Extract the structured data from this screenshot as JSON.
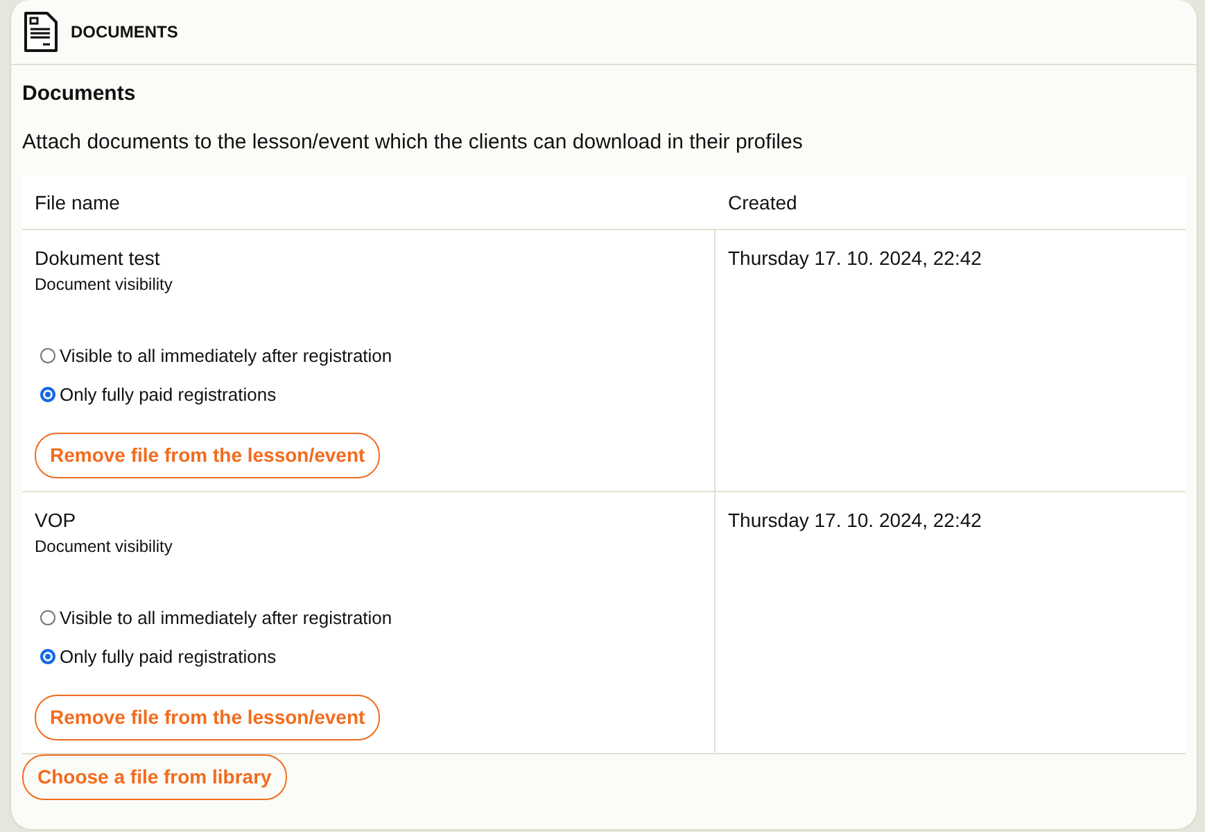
{
  "panel": {
    "title": "DOCUMENTS"
  },
  "section": {
    "heading": "Documents",
    "description": "Attach documents to the lesson/event which the clients can download in their profiles"
  },
  "table": {
    "columns": [
      "File name",
      "Created"
    ],
    "rows": [
      {
        "name": "Dokument test",
        "visibility_label": "Document visibility",
        "options": [
          {
            "label": "Visible to all immediately after registration",
            "selected": false
          },
          {
            "label": "Only fully paid registrations",
            "selected": true
          }
        ],
        "remove_button": "Remove file from the lesson/event",
        "created": "Thursday 17. 10. 2024, 22:42"
      },
      {
        "name": "VOP",
        "visibility_label": "Document visibility",
        "options": [
          {
            "label": "Visible to all immediately after registration",
            "selected": false
          },
          {
            "label": "Only fully paid registrations",
            "selected": true
          }
        ],
        "remove_button": "Remove file from the lesson/event",
        "created": "Thursday 17. 10. 2024, 22:42"
      }
    ]
  },
  "library_button": "Choose a file from library"
}
